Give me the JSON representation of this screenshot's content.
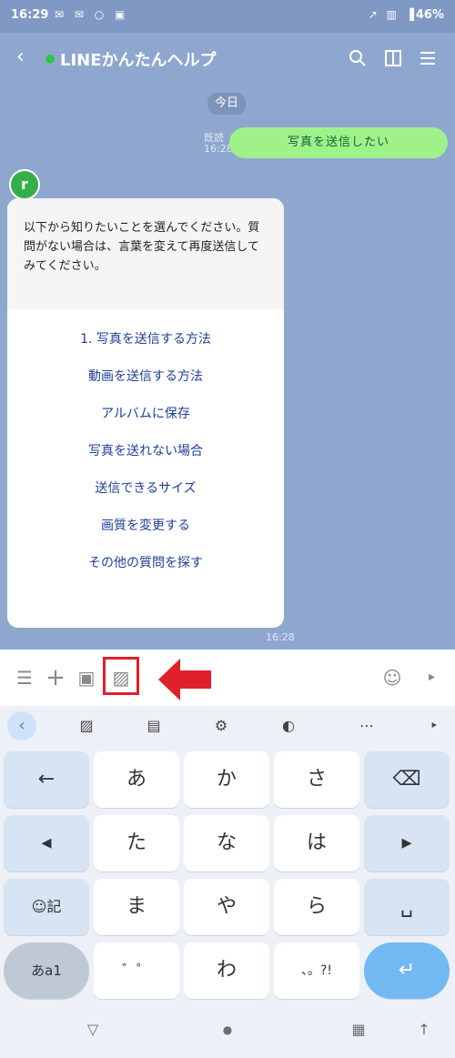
{
  "status_bar": {
    "time": "16:29",
    "left_icons": "✉ ✉ ○ ▣",
    "right_icons": "↗ ▥ ▐",
    "battery": "46%"
  },
  "header": {
    "back": "‹",
    "title": "LINEかんたんヘルプ",
    "search_icon": "⌕",
    "menu_icon": "☰"
  },
  "chat": {
    "date_badge": "今日",
    "sent_message": "写真を送信したい",
    "sent_time": "既読\n16:28",
    "avatar_letter": "r",
    "card_intro": "以下から知りたいことを選んでください。質問がない場合は、言葉を変えて再度送信してみてください。",
    "card_links": [
      "1. 写真を送信する方法",
      "動画を送信する方法",
      "アルバムに保存",
      "写真を送れない場合",
      "送信できるサイズ",
      "画質を変更する",
      "その他の質問を探す"
    ],
    "card_time": "16:28"
  },
  "input_bar": {
    "menu_icon": "☰",
    "plus_icon": "+",
    "camera_icon": "▣",
    "image_icon": "▨",
    "emoji_icon": "☺",
    "mic_icon": "‣"
  },
  "keyboard": {
    "toolbar": {
      "back": "‹",
      "sticker": "▨",
      "clipboard": "▤",
      "settings": "⚙",
      "palette": "◐",
      "more": "⋯",
      "mic": "‣"
    },
    "rows": [
      [
        "←",
        "あ",
        "か",
        "さ",
        "⌫"
      ],
      [
        "◂",
        "た",
        "な",
        "は",
        "▸"
      ],
      [
        "☺記",
        "ま",
        "や",
        "ら",
        "␣"
      ],
      [
        "あa1",
        "゛゜",
        "わ",
        "、。?!",
        "↵"
      ]
    ],
    "nav": {
      "down": "▽",
      "home": "●",
      "apps": "▦",
      "up": "↑"
    }
  },
  "highlight_color": "#e0202b",
  "accent_green": "#2fc44a",
  "bubble_green": "#9ff28a"
}
